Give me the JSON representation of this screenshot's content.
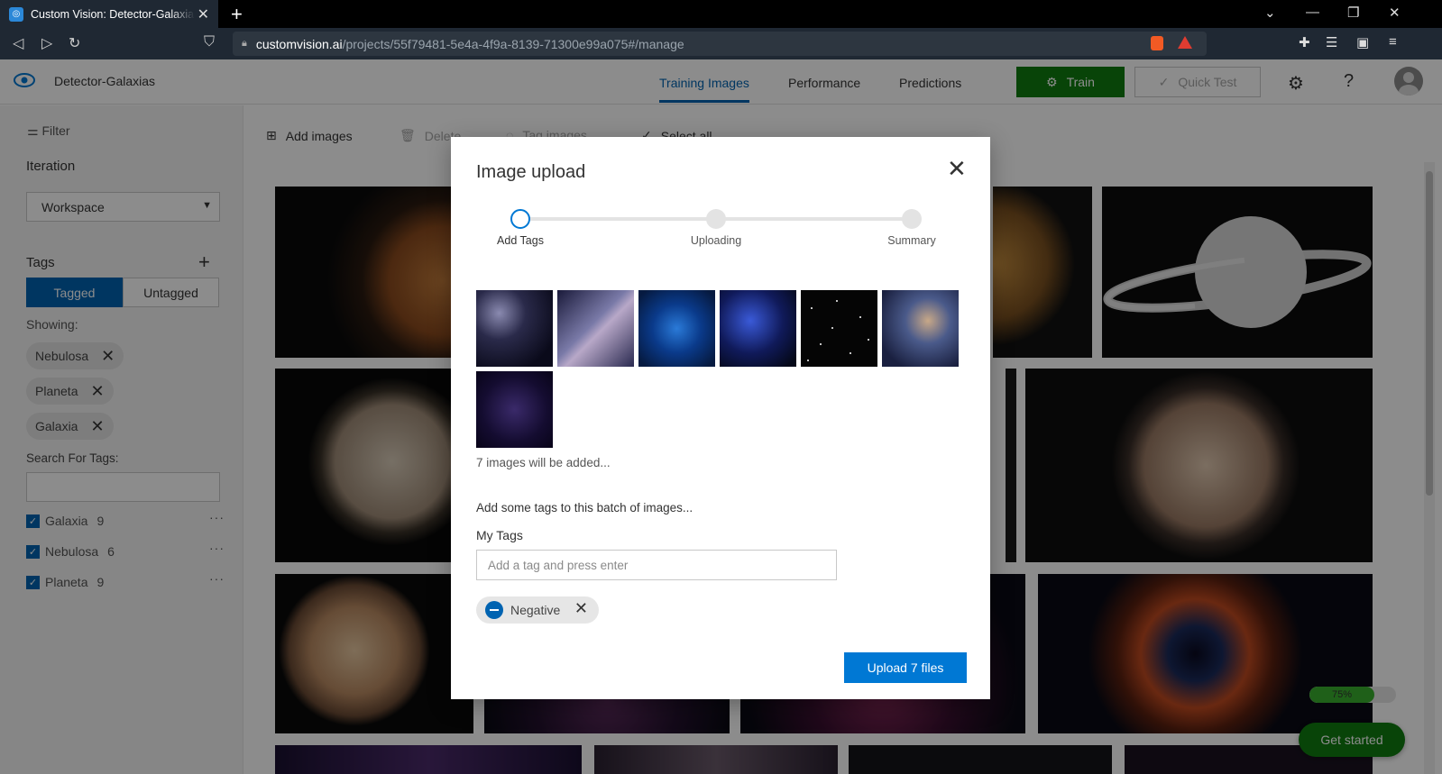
{
  "browser": {
    "tab_title": "Custom Vision: Detector-Galaxias",
    "url_host": "customvision.ai",
    "url_path": "/projects/55f79481-5e4a-4f9a-8139-71300e99a075#/manage"
  },
  "header": {
    "project_name": "Detector-Galaxias",
    "tabs": [
      {
        "label": "Training Images",
        "active": true
      },
      {
        "label": "Performance",
        "active": false
      },
      {
        "label": "Predictions",
        "active": false
      }
    ],
    "train_label": "Train",
    "quick_test_label": "Quick Test"
  },
  "sidebar": {
    "filter_label": "Filter",
    "iteration_heading": "Iteration",
    "iteration_value": "Workspace",
    "tags_heading": "Tags",
    "tagged_label": "Tagged",
    "untagged_label": "Untagged",
    "showing_label": "Showing:",
    "showing_pills": [
      "Nebulosa",
      "Planeta",
      "Galaxia"
    ],
    "search_label": "Search For Tags:",
    "tag_list": [
      {
        "name": "Galaxia",
        "count": "9",
        "checked": true
      },
      {
        "name": "Nebulosa",
        "count": "6",
        "checked": true
      },
      {
        "name": "Planeta",
        "count": "9",
        "checked": true
      }
    ]
  },
  "toolbar": {
    "add_images": "Add images",
    "delete": "Delete",
    "tag_images": "Tag images",
    "select_all": "Select all"
  },
  "modal": {
    "title": "Image upload",
    "steps": [
      {
        "label": "Add Tags",
        "current": true
      },
      {
        "label": "Uploading",
        "current": false
      },
      {
        "label": "Summary",
        "current": false
      }
    ],
    "images_added_text": "7 images will be added...",
    "batch_heading": "Add some tags to this batch of images...",
    "my_tags_label": "My Tags",
    "tag_input_placeholder": "Add a tag and press enter",
    "negative_tag": "Negative",
    "upload_button": "Upload 7 files"
  },
  "widgets": {
    "progress_percent": 75,
    "progress_label": "75%",
    "get_started": "Get started"
  },
  "colors": {
    "accent": "#0078d4",
    "train_green": "#107c10",
    "progress_green": "#3ab02e"
  }
}
